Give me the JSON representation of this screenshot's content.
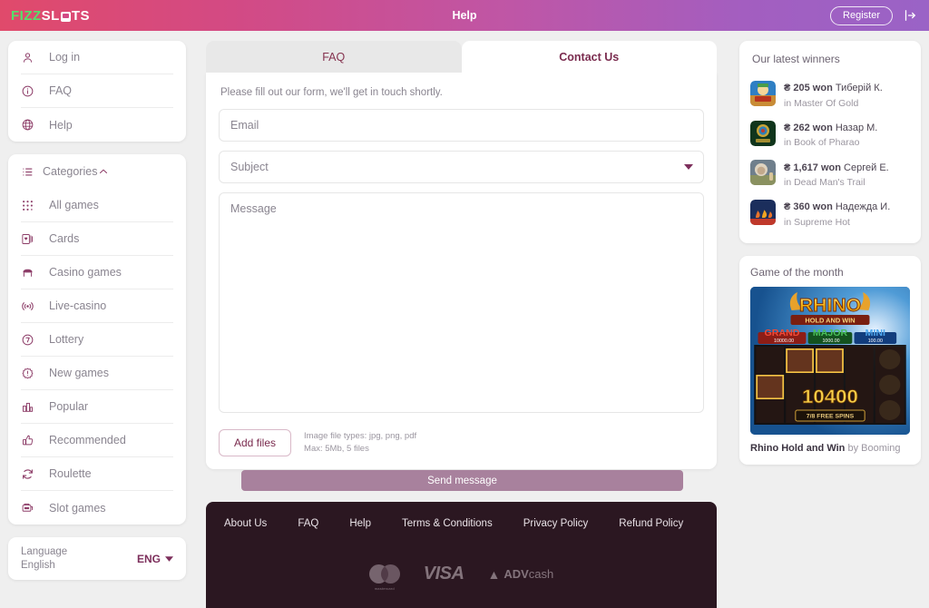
{
  "header": {
    "logo_fizz": "FIZZ",
    "logo_slots_a": "SL",
    "logo_slots_b": "TS",
    "title": "Help",
    "register_label": "Register",
    "login_icon": "login-arrow-icon"
  },
  "sidebar": {
    "account_items": [
      {
        "label": "Log in",
        "icon": "user-icon"
      },
      {
        "label": "FAQ",
        "icon": "info-circle-icon"
      },
      {
        "label": "Help",
        "icon": "globe-icon"
      }
    ],
    "categories_header": {
      "label": "Categories",
      "icon": "list-icon",
      "chevron": "chevron-up-icon"
    },
    "categories": [
      {
        "label": "All games",
        "icon": "grid-dots-icon"
      },
      {
        "label": "Cards",
        "icon": "playing-card-icon"
      },
      {
        "label": "Casino games",
        "icon": "casino-table-icon"
      },
      {
        "label": "Live-casino",
        "icon": "broadcast-icon"
      },
      {
        "label": "Lottery",
        "icon": "lottery-seven-icon"
      },
      {
        "label": "New games",
        "icon": "new-badge-icon"
      },
      {
        "label": "Popular",
        "icon": "bar-chart-icon"
      },
      {
        "label": "Recommended",
        "icon": "thumbs-up-icon"
      },
      {
        "label": "Roulette",
        "icon": "refresh-circle-icon"
      },
      {
        "label": "Slot games",
        "icon": "slot-machine-icon"
      }
    ],
    "language": {
      "label": "Language",
      "value": "English",
      "code": "ENG",
      "caret": "caret-down-icon"
    }
  },
  "main": {
    "tabs": [
      {
        "label": "FAQ",
        "active": false
      },
      {
        "label": "Contact Us",
        "active": true
      }
    ],
    "note": "Please fill out our form, we'll get in touch shortly.",
    "email_placeholder": "Email",
    "email_value": "",
    "subject_placeholder": "Subject",
    "subject_value": "",
    "subject_caret": "caret-down-icon",
    "message_placeholder": "Message",
    "message_value": "",
    "add_files_label": "Add files",
    "file_note_line1": "Image file types: jpg, png, pdf",
    "file_note_line2": "Max: 5Mb, 5 files",
    "send_label": "Send message"
  },
  "footer": {
    "links": [
      "About Us",
      "FAQ",
      "Help",
      "Terms & Conditions",
      "Privacy Policy",
      "Refund Policy"
    ],
    "payments": [
      {
        "name": "mastercard",
        "caption": "mastercard"
      },
      {
        "name": "visa",
        "label": "VISA"
      },
      {
        "name": "advcash",
        "label_bold": "ADV",
        "label_rest": "cash"
      }
    ]
  },
  "right_sidebar": {
    "winners_title": "Our latest winners",
    "winners": [
      {
        "amount": "₴ 205 won",
        "player": "Тиберій К.",
        "game": "in Master Of Gold",
        "thumb": "master-of-gold-thumb"
      },
      {
        "amount": "₴ 262 won",
        "player": "Назар М.",
        "game": "in Book of Pharao",
        "thumb": "book-of-pharao-thumb"
      },
      {
        "amount": "₴ 1,617 won",
        "player": "Сергей Е.",
        "game": "in Dead Man's Trail",
        "thumb": "dead-mans-trail-thumb"
      },
      {
        "amount": "₴ 360 won",
        "player": "Надежда И.",
        "game": "in Supreme Hot",
        "thumb": "supreme-hot-thumb"
      }
    ],
    "game_of_month": {
      "title": "Game of the month",
      "game_name": "Rhino Hold and Win",
      "provider": " by Booming",
      "art": {
        "logo_top": "RHINO",
        "logo_sub": "HOLD AND WIN",
        "jackpot_grand": "GRAND",
        "jackpot_grand_value": "10000.00",
        "jackpot_major": "MAJOR",
        "jackpot_major_value": "1000.00",
        "jackpot_mini": "MINI",
        "jackpot_mini_value": "100.00",
        "big_win": "10400",
        "free_spins": "7/8  FREE SPINS"
      }
    }
  },
  "colors": {
    "header_from": "#e04a6b",
    "header_to": "#9a63c6",
    "accent": "#7d2f5c",
    "muted": "#8a8590",
    "send_button": "#a8819d",
    "footer_bg": "#2b1721"
  }
}
